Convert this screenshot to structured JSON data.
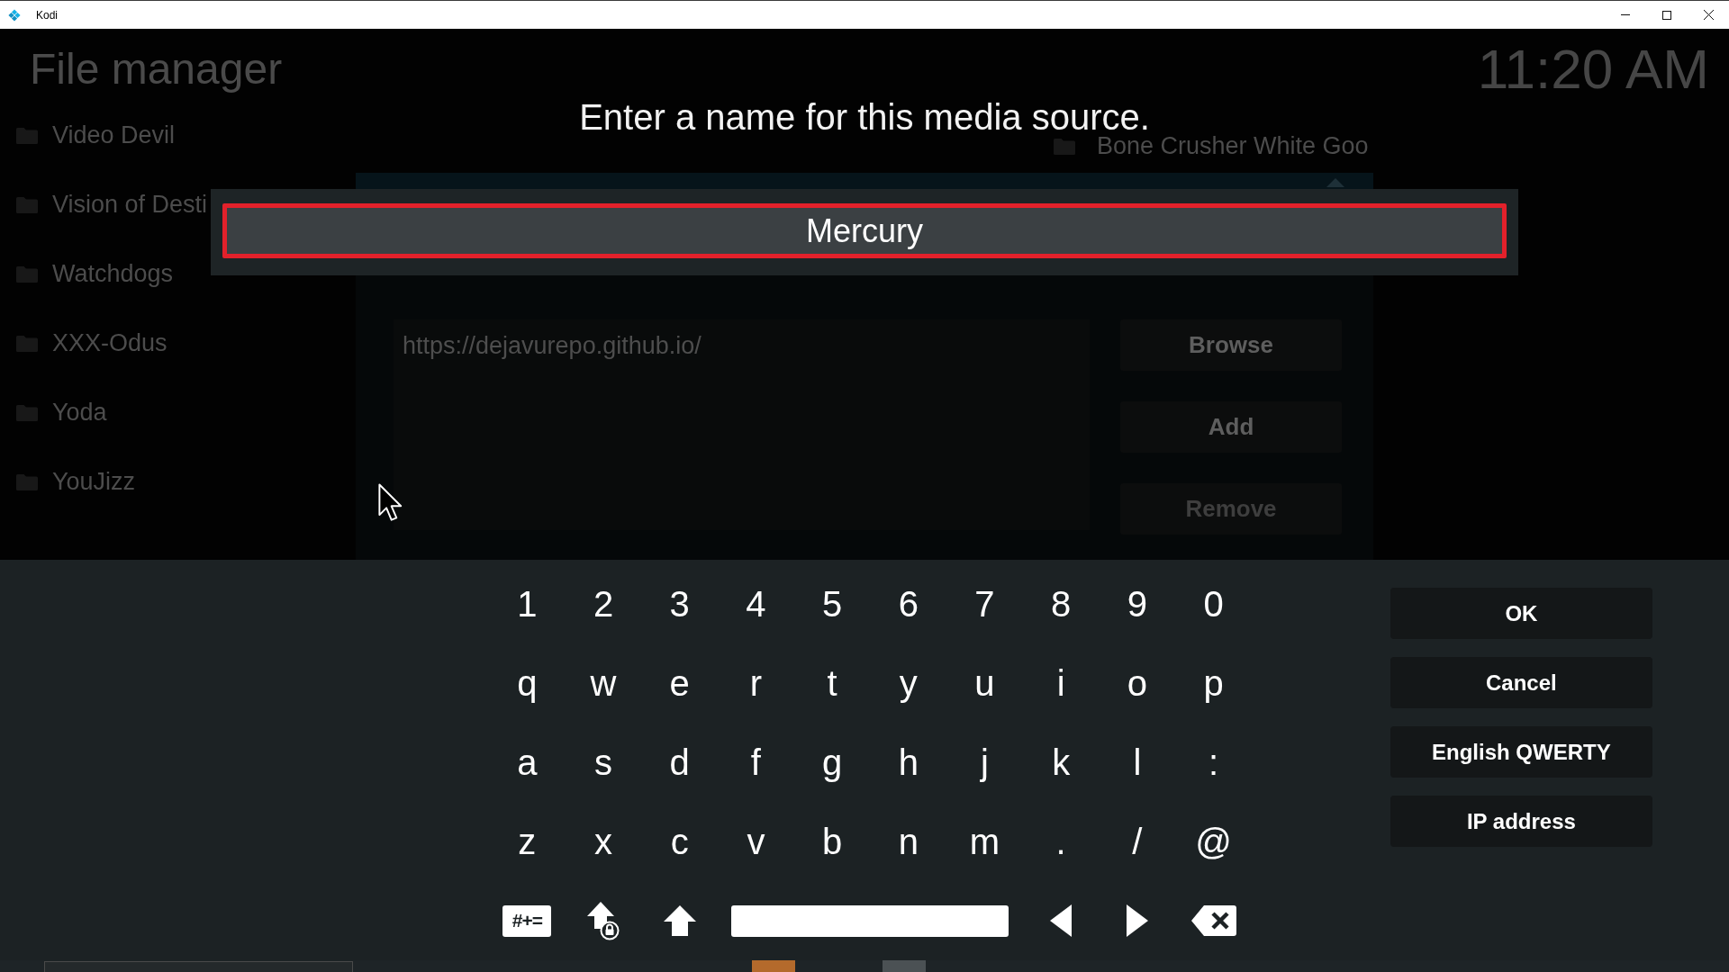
{
  "window": {
    "title": "Kodi"
  },
  "file_manager": {
    "title": "File manager",
    "clock": "11:20 AM",
    "left_pane": [
      "Video Devil",
      "Vision of Desti",
      "Watchdogs",
      "XXX-Odus",
      "Yoda",
      "YouJizz"
    ],
    "right_pane": [
      "Bone Crusher White Goo"
    ]
  },
  "source_dialog": {
    "paths": [
      "https://dejavurepo.github.io/"
    ],
    "buttons": [
      {
        "label": "Browse",
        "disabled": false
      },
      {
        "label": "Add",
        "disabled": false
      },
      {
        "label": "Remove",
        "disabled": true
      }
    ]
  },
  "name_prompt": {
    "title": "Enter a name for this media source.",
    "value": "Mercury",
    "focused": true
  },
  "keyboard": {
    "rows": [
      [
        "1",
        "2",
        "3",
        "4",
        "5",
        "6",
        "7",
        "8",
        "9",
        "0"
      ],
      [
        "q",
        "w",
        "e",
        "r",
        "t",
        "y",
        "u",
        "i",
        "o",
        "p"
      ],
      [
        "a",
        "s",
        "d",
        "f",
        "g",
        "h",
        "j",
        "k",
        "l",
        ":"
      ],
      [
        "z",
        "x",
        "c",
        "v",
        "b",
        "n",
        "m",
        ".",
        "/",
        "@"
      ]
    ],
    "bottom_row": [
      {
        "kind": "symbols",
        "label": "#+="
      },
      {
        "kind": "caps_lock"
      },
      {
        "kind": "shift"
      },
      {
        "kind": "space"
      },
      {
        "kind": "left"
      },
      {
        "kind": "right"
      },
      {
        "kind": "backspace"
      }
    ]
  },
  "actions": [
    "OK",
    "Cancel",
    "English QWERTY",
    "IP address"
  ]
}
